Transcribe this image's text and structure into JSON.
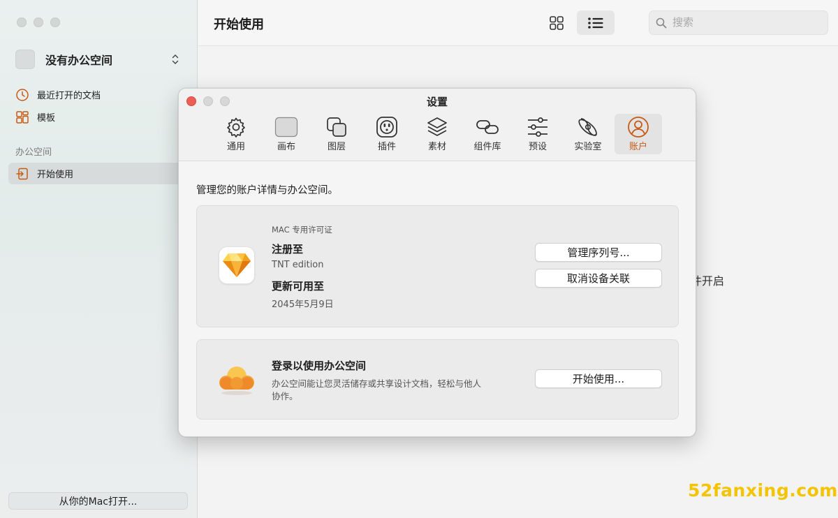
{
  "sidebar": {
    "workspace_label": "没有办公空间",
    "items": [
      {
        "label": "最近打开的文档",
        "icon": "clock-icon"
      },
      {
        "label": "模板",
        "icon": "templates-icon"
      }
    ],
    "section_label": "办公空间",
    "active_item": {
      "label": "开始使用",
      "icon": "getting-started-icon"
    },
    "open_mac_label": "从你的Mac打开..."
  },
  "header": {
    "title": "开始使用",
    "search_placeholder": "搜索"
  },
  "background_hint": "件开启",
  "watermark": "52fanxing.com",
  "dialog": {
    "title": "设置",
    "tabs": [
      {
        "label": "通用",
        "icon": "gear-icon"
      },
      {
        "label": "画布",
        "icon": "canvas-icon"
      },
      {
        "label": "图层",
        "icon": "layers-icon"
      },
      {
        "label": "插件",
        "icon": "plugin-icon"
      },
      {
        "label": "素材",
        "icon": "assets-icon"
      },
      {
        "label": "组件库",
        "icon": "link-icon"
      },
      {
        "label": "预设",
        "icon": "sliders-icon"
      },
      {
        "label": "实验室",
        "icon": "atom-icon"
      },
      {
        "label": "账户",
        "icon": "account-icon"
      }
    ],
    "active_tab": "账户",
    "description": "管理您的账户详情与办公空间。",
    "license": {
      "heading": "MAC 专用许可证",
      "registered_label": "注册至",
      "registered_value": "TNT edition",
      "updates_label": "更新可用至",
      "updates_value": "2045年5月9日",
      "manage_button": "管理序列号...",
      "unlink_button": "取消设备关联"
    },
    "workspace": {
      "title": "登录以使用办公空间",
      "description_line1": "办公空间能让您灵活储存或共享设计文档，轻松与他人",
      "description_line2": "协作。",
      "start_button": "开始使用..."
    }
  },
  "colors": {
    "accent": "#c65a14",
    "close": "#ec5f57",
    "watermark": "#f5c400"
  }
}
